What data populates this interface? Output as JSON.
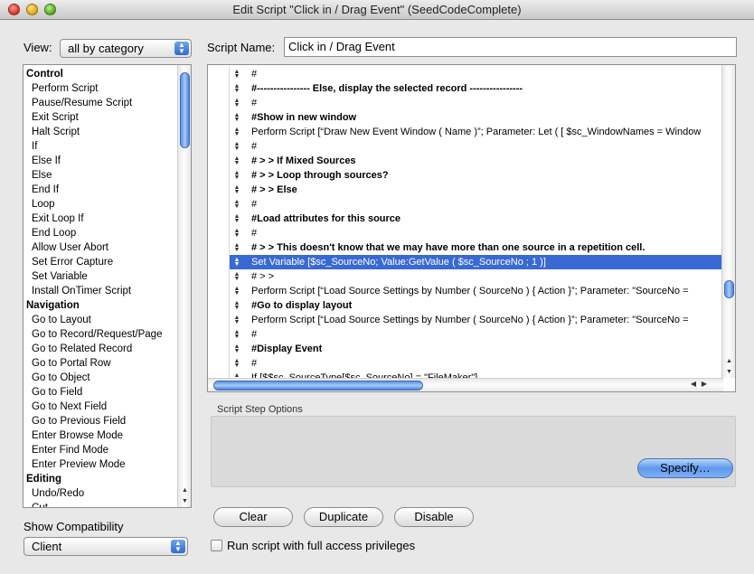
{
  "window": {
    "title": "Edit Script \"Click in / Drag Event\" (SeedCodeComplete)"
  },
  "view": {
    "label": "View:",
    "selected": "all by category"
  },
  "script_name": {
    "label": "Script Name:",
    "value": "Click in / Drag Event"
  },
  "steps_list": [
    {
      "type": "category",
      "label": "Control"
    },
    {
      "type": "item",
      "label": "Perform Script"
    },
    {
      "type": "item",
      "label": "Pause/Resume Script"
    },
    {
      "type": "item",
      "label": "Exit Script"
    },
    {
      "type": "item",
      "label": "Halt Script"
    },
    {
      "type": "item",
      "label": "If"
    },
    {
      "type": "item",
      "label": "Else If"
    },
    {
      "type": "item",
      "label": "Else"
    },
    {
      "type": "item",
      "label": "End If"
    },
    {
      "type": "item",
      "label": "Loop"
    },
    {
      "type": "item",
      "label": "Exit Loop If"
    },
    {
      "type": "item",
      "label": "End Loop"
    },
    {
      "type": "item",
      "label": "Allow User Abort"
    },
    {
      "type": "item",
      "label": "Set Error Capture"
    },
    {
      "type": "item",
      "label": "Set Variable"
    },
    {
      "type": "item",
      "label": "Install OnTimer Script"
    },
    {
      "type": "category",
      "label": "Navigation"
    },
    {
      "type": "item",
      "label": "Go to Layout"
    },
    {
      "type": "item",
      "label": "Go to Record/Request/Page"
    },
    {
      "type": "item",
      "label": "Go to Related Record"
    },
    {
      "type": "item",
      "label": "Go to Portal Row"
    },
    {
      "type": "item",
      "label": "Go to Object"
    },
    {
      "type": "item",
      "label": "Go to Field"
    },
    {
      "type": "item",
      "label": "Go to Next Field"
    },
    {
      "type": "item",
      "label": "Go to Previous Field"
    },
    {
      "type": "item",
      "label": "Enter Browse Mode"
    },
    {
      "type": "item",
      "label": "Enter Find Mode"
    },
    {
      "type": "item",
      "label": "Enter Preview Mode"
    },
    {
      "type": "category",
      "label": "Editing"
    },
    {
      "type": "item",
      "label": "Undo/Redo"
    },
    {
      "type": "item",
      "label": "Cut"
    }
  ],
  "script_lines": [
    {
      "text": "#",
      "bold": false,
      "selected": false
    },
    {
      "text": "#----------------  Else, display the selected record  ----------------",
      "bold": true,
      "selected": false
    },
    {
      "text": "#",
      "bold": false,
      "selected": false
    },
    {
      "text": "#Show in new window",
      "bold": true,
      "selected": false
    },
    {
      "text": "Perform Script [“Draw New Event Window ( Name )”; Parameter: Let ( [ $sc_WindowNames = Window",
      "bold": false,
      "selected": false
    },
    {
      "text": "#",
      "bold": false,
      "selected": false
    },
    {
      "text": "# > > If Mixed Sources",
      "bold": true,
      "selected": false
    },
    {
      "text": "# > > Loop through sources?",
      "bold": true,
      "selected": false
    },
    {
      "text": "# > > Else",
      "bold": true,
      "selected": false
    },
    {
      "text": "#",
      "bold": false,
      "selected": false
    },
    {
      "text": "#Load attributes for this source",
      "bold": true,
      "selected": false
    },
    {
      "text": "#",
      "bold": false,
      "selected": false
    },
    {
      "text": "# > > This doesn't know that we may have more than one source in a repetition cell.",
      "bold": true,
      "selected": false
    },
    {
      "text": "Set Variable [$sc_SourceNo; Value:GetValue ( $sc_SourceNo ; 1 )]",
      "bold": false,
      "selected": true
    },
    {
      "text": "# > >",
      "bold": false,
      "selected": false
    },
    {
      "text": "Perform Script [“Load Source Settings by Number ( SourceNo ) { Action }”; Parameter: \"SourceNo =",
      "bold": false,
      "selected": false
    },
    {
      "text": "#Go to display layout",
      "bold": true,
      "selected": false
    },
    {
      "text": "Perform Script [“Load Source Settings by Number ( SourceNo ) { Action }”; Parameter: \"SourceNo =",
      "bold": false,
      "selected": false
    },
    {
      "text": "#",
      "bold": false,
      "selected": false
    },
    {
      "text": "#Display Event",
      "bold": true,
      "selected": false
    },
    {
      "text": "#",
      "bold": false,
      "selected": false
    },
    {
      "text": "If [$$sc_SourceType[$sc_SourceNo] = \"FileMaker\"]",
      "bold": false,
      "selected": false
    }
  ],
  "options": {
    "label": "Script Step Options",
    "specify_label": "Specify…"
  },
  "buttons": {
    "clear": "Clear",
    "duplicate": "Duplicate",
    "disable": "Disable"
  },
  "compatibility": {
    "label": "Show Compatibility",
    "selected": "Client"
  },
  "full_access": {
    "label": "Run script with full access privileges",
    "checked": false
  },
  "colors": {
    "selection": "#3969d3",
    "accent": "#5f98ec"
  }
}
